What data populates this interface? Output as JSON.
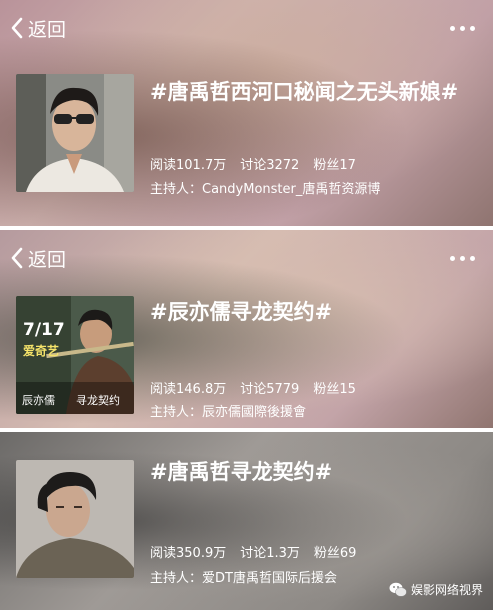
{
  "cards": [
    {
      "back_label": "返回",
      "title": "#唐禹哲西河口秘闻之无头新娘#",
      "stats": [
        "阅读101.7万",
        "讨论3272",
        "粉丝17"
      ],
      "host": "主持人：CandyMonster_唐禹哲资源博"
    },
    {
      "back_label": "返回",
      "title": "#辰亦儒寻龙契约#",
      "stats": [
        "阅读146.8万",
        "讨论5779",
        "粉丝15"
      ],
      "host": "主持人：辰亦儒國際後援會",
      "poster_date": "7/17",
      "poster_brand": "爱奇艺",
      "poster_name": "辰亦儒",
      "poster_show": "寻龙契约"
    },
    {
      "title": "#唐禹哲寻龙契约#",
      "stats": [
        "阅读350.9万",
        "讨论1.3万",
        "粉丝69"
      ],
      "host": "主持人：爱DT唐禹哲国际后援会"
    }
  ],
  "watermark": "娱影网络视界",
  "icons": [
    "chevron-left-icon",
    "more-dots-icon",
    "wechat-icon"
  ]
}
